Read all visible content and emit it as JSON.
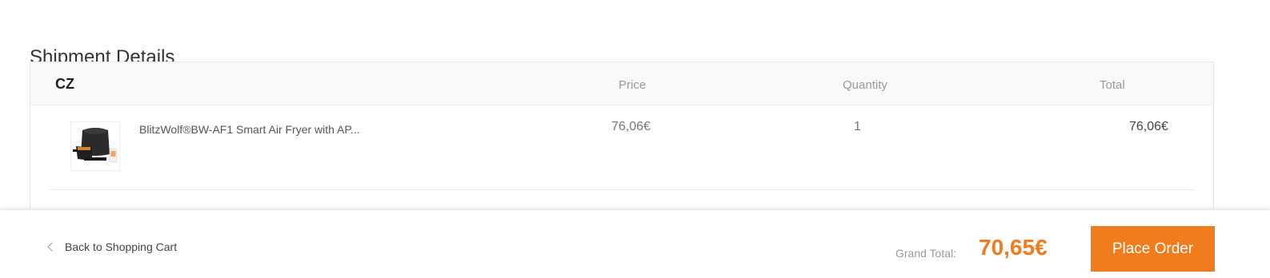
{
  "section": {
    "title": "Shipment Details"
  },
  "shipment": {
    "country": "CZ",
    "headers": {
      "price": "Price",
      "quantity": "Quantity",
      "total": "Total"
    },
    "items": [
      {
        "name": "BlitzWolf®BW-AF1 Smart Air Fryer with AP...",
        "price": "76,06€",
        "quantity": "1",
        "total": "76,06€",
        "image": "air-fryer-product-image"
      }
    ]
  },
  "footer": {
    "back_label": "Back to Shopping Cart",
    "grand_total_label": "Grand Total:",
    "grand_total_value": "70,65€",
    "place_order_label": "Place Order"
  },
  "colors": {
    "accent": "#f07c1e",
    "header_bg": "#f9f9f9",
    "border": "#e5e5e5"
  }
}
